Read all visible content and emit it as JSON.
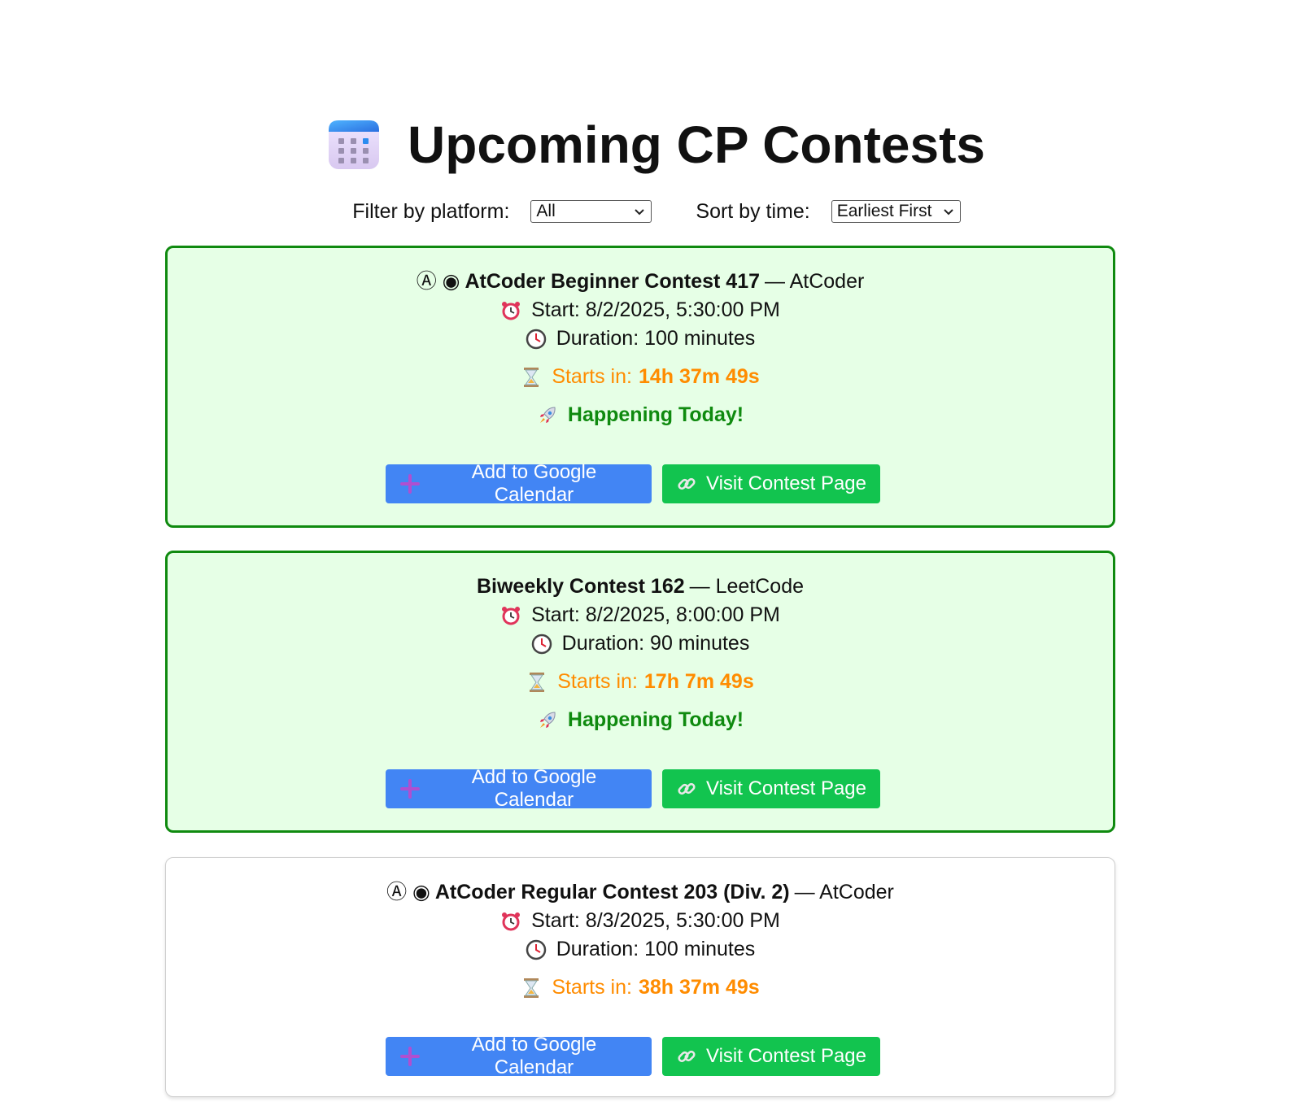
{
  "header": {
    "title": "Upcoming CP Contests",
    "icon": "calendar-icon"
  },
  "controls": {
    "filter_label": "Filter by platform:",
    "filter_value": "All",
    "sort_label": "Sort by time:",
    "sort_value": "Earliest First"
  },
  "colors": {
    "today_bg": "#e6ffe6",
    "today_border": "#0f8a0f",
    "countdown": "#ff8c00",
    "calendar_button": "#4285f4",
    "visit_button": "#12c44f"
  },
  "contests": [
    {
      "prefix": "Ⓐ ◉",
      "name": "AtCoder Beginner Contest 417",
      "platform": "— AtCoder",
      "start": "Start: 8/2/2025, 5:30:00 PM",
      "duration": "Duration: 100 minutes",
      "countdown_label": "Starts in:",
      "countdown_value": "14h 37m 49s",
      "today_message": "Happening Today!",
      "calendar_button": "Add to Google Calendar",
      "visit_button": "Visit Contest Page"
    },
    {
      "prefix": "",
      "name": "Biweekly Contest 162",
      "platform": "— LeetCode",
      "start": "Start: 8/2/2025, 8:00:00 PM",
      "duration": "Duration: 90 minutes",
      "countdown_label": "Starts in:",
      "countdown_value": "17h 7m 49s",
      "today_message": "Happening Today!",
      "calendar_button": "Add to Google Calendar",
      "visit_button": "Visit Contest Page"
    },
    {
      "prefix": "Ⓐ ◉",
      "name": "AtCoder Regular Contest 203 (Div. 2)",
      "platform": "— AtCoder",
      "start": "Start: 8/3/2025, 5:30:00 PM",
      "duration": "Duration: 100 minutes",
      "countdown_label": "Starts in:",
      "countdown_value": "38h 37m 49s",
      "calendar_button": "Add to Google Calendar",
      "visit_button": "Visit Contest Page"
    }
  ]
}
